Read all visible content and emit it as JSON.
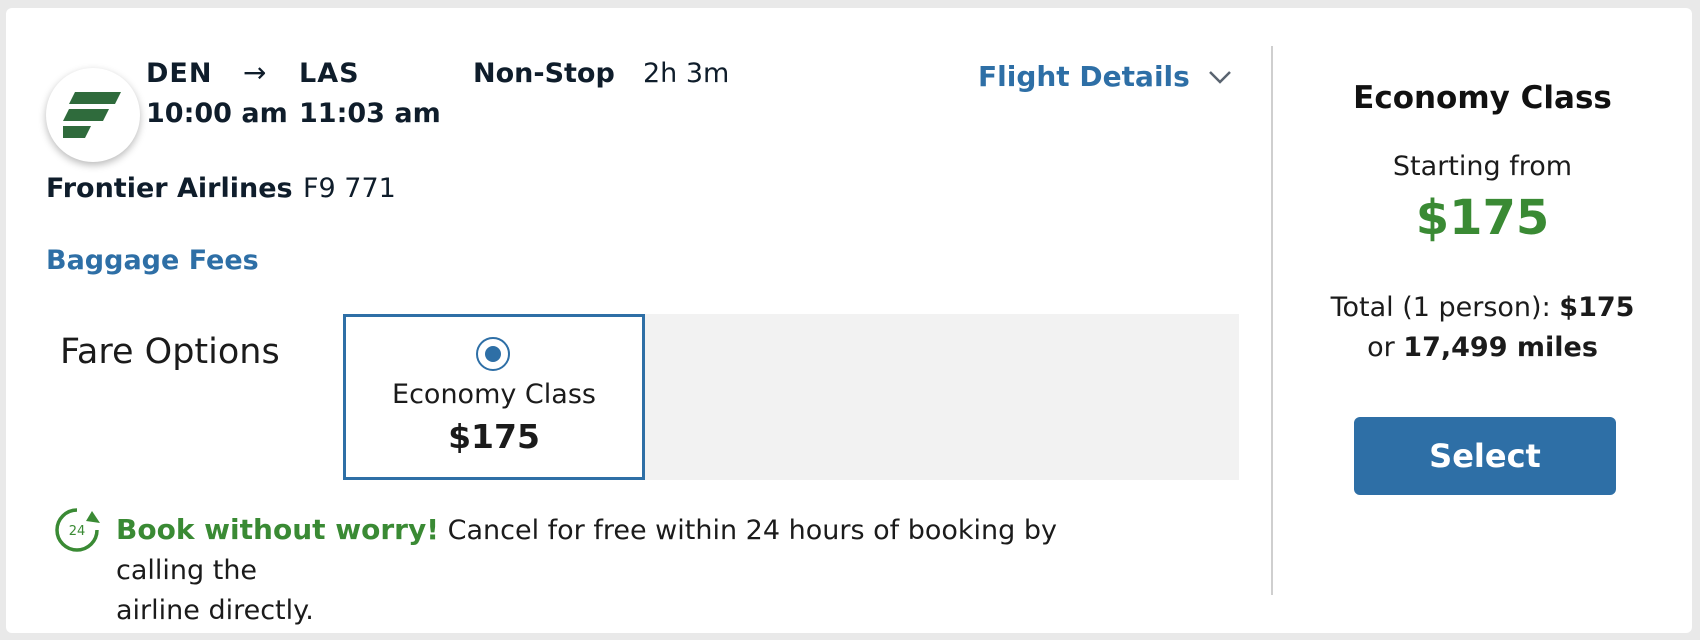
{
  "flight": {
    "origin": "DEN",
    "destination": "LAS",
    "arrow": "→",
    "depart_time": "10:00 am",
    "arrive_time": "11:03 am",
    "stops": "Non-Stop",
    "duration": "2h 3m",
    "details_link": "Flight Details",
    "airline_name": "Frontier Airlines",
    "flight_number": "F9 771",
    "baggage_link": "Baggage Fees"
  },
  "fare_options": {
    "label": "Fare Options",
    "options": [
      {
        "name": "Economy Class",
        "price": "$175",
        "selected": true
      }
    ]
  },
  "worry_free": {
    "badge_text": "24",
    "title": "Book without worry!",
    "text_line1": "Cancel for free within 24 hours of booking by calling the",
    "text_line2": "airline directly."
  },
  "summary": {
    "class_title": "Economy Class",
    "starting_from": "Starting from",
    "price": "$175",
    "total_prefix": "Total (1 person):",
    "total_price": "$175",
    "miles_prefix": "or",
    "miles": "17,499 miles",
    "select_button": "Select"
  },
  "colors": {
    "link_blue": "#2e6fa6",
    "price_green": "#3a8a34",
    "frontier_green": "#2f6b3c"
  },
  "icons": {
    "logo": "frontier-logo-icon",
    "chevron": "chevron-down-icon",
    "cancel_badge": "24-hour-cancel-icon"
  }
}
